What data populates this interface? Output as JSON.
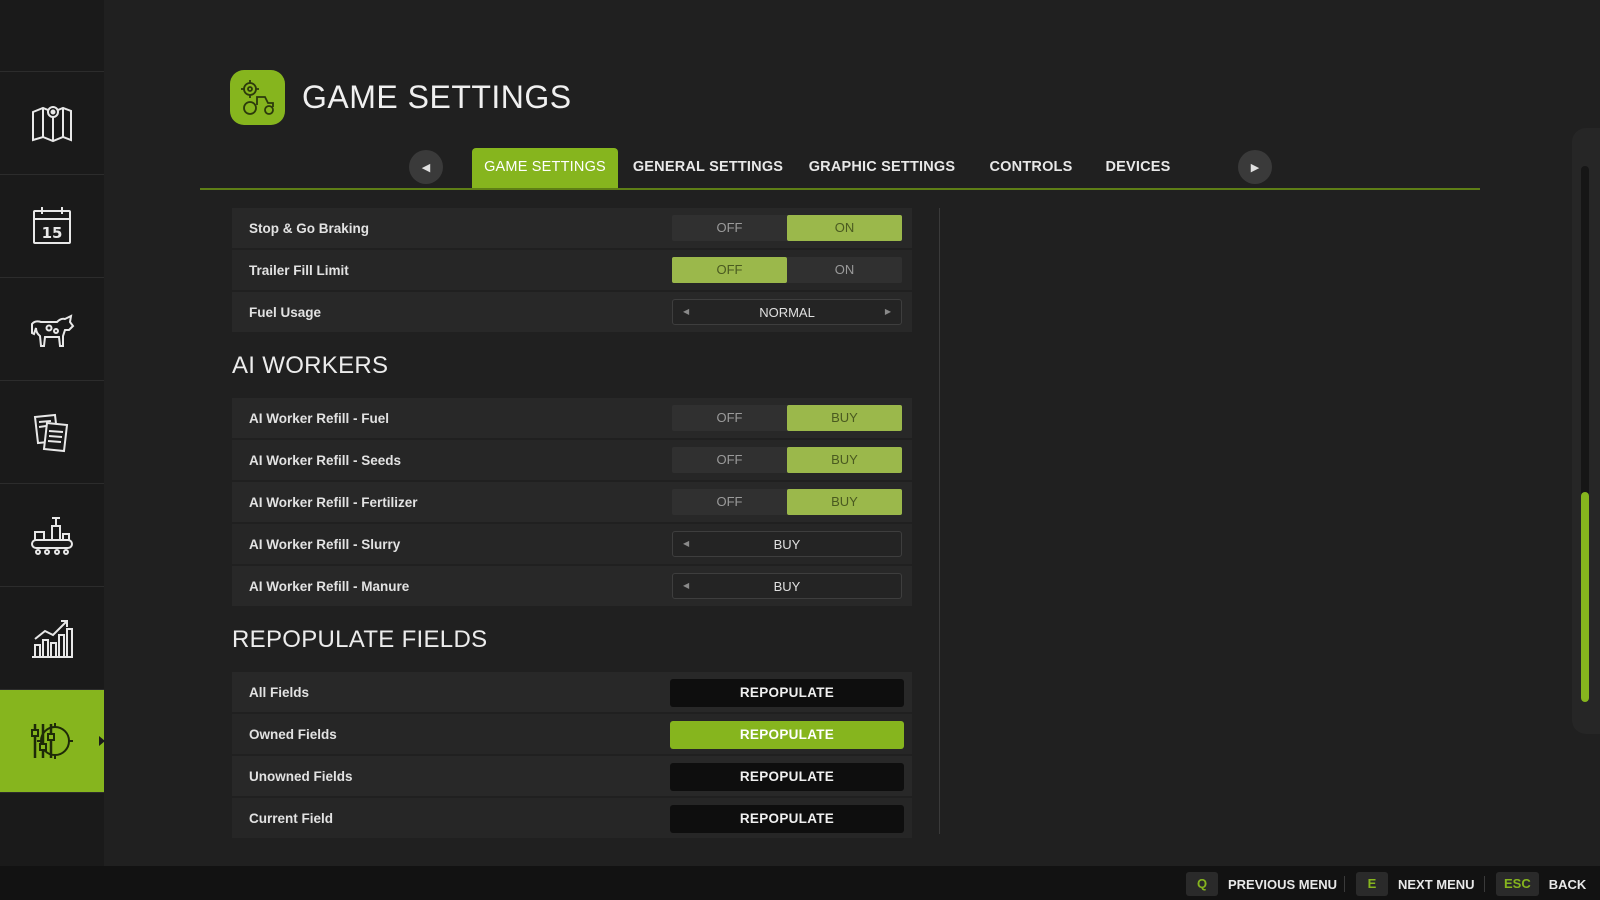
{
  "header": {
    "title": "GAME SETTINGS",
    "logo_icon": "tractor-gear-icon"
  },
  "sidebar": {
    "items": [
      {
        "name": "map",
        "icon": "map-icon",
        "active": false
      },
      {
        "name": "calendar",
        "icon": "calendar-icon",
        "label": "15",
        "active": false
      },
      {
        "name": "animals",
        "icon": "cow-icon",
        "active": false
      },
      {
        "name": "contracts",
        "icon": "documents-icon",
        "active": false
      },
      {
        "name": "production",
        "icon": "factory-icon",
        "active": false
      },
      {
        "name": "statistics",
        "icon": "bar-chart-icon",
        "active": false
      },
      {
        "name": "settings",
        "icon": "settings-sliders-icon",
        "active": true
      }
    ]
  },
  "tabs": [
    {
      "label": "GAME SETTINGS",
      "active": true
    },
    {
      "label": "GENERAL SETTINGS",
      "active": false
    },
    {
      "label": "GRAPHIC SETTINGS",
      "active": false
    },
    {
      "label": "CONTROLS",
      "active": false
    },
    {
      "label": "DEVICES",
      "active": false
    }
  ],
  "settings_top": [
    {
      "label": "Stop & Go Braking",
      "type": "toggle",
      "options": [
        "OFF",
        "ON"
      ],
      "selected": 1
    },
    {
      "label": "Trailer Fill Limit",
      "type": "toggle",
      "options": [
        "OFF",
        "ON"
      ],
      "selected": 0
    },
    {
      "label": "Fuel Usage",
      "type": "selector",
      "value": "NORMAL"
    }
  ],
  "sections": {
    "ai_workers": "AI WORKERS",
    "repopulate": "REPOPULATE FIELDS"
  },
  "ai_workers": [
    {
      "label": "AI Worker Refill - Fuel",
      "type": "toggle",
      "options": [
        "OFF",
        "BUY"
      ],
      "selected": 1
    },
    {
      "label": "AI Worker Refill - Seeds",
      "type": "toggle",
      "options": [
        "OFF",
        "BUY"
      ],
      "selected": 1
    },
    {
      "label": "AI Worker Refill - Fertilizer",
      "type": "toggle",
      "options": [
        "OFF",
        "BUY"
      ],
      "selected": 1
    },
    {
      "label": "AI Worker Refill - Slurry",
      "type": "selector",
      "value": "BUY"
    },
    {
      "label": "AI Worker Refill - Manure",
      "type": "selector",
      "value": "BUY"
    }
  ],
  "repopulate": [
    {
      "label": "All Fields",
      "button": "REPOPULATE",
      "highlight": false
    },
    {
      "label": "Owned Fields",
      "button": "REPOPULATE",
      "highlight": true
    },
    {
      "label": "Unowned Fields",
      "button": "REPOPULATE",
      "highlight": false
    },
    {
      "label": "Current Field",
      "button": "REPOPULATE",
      "highlight": false
    }
  ],
  "footer": {
    "prev": {
      "key": "Q",
      "label": "PREVIOUS MENU"
    },
    "next": {
      "key": "E",
      "label": "NEXT MENU"
    },
    "back": {
      "key": "ESC",
      "label": "BACK"
    }
  },
  "colors": {
    "accent": "#86b51e",
    "toggle_on": "#9bb84b",
    "background": "#202020"
  }
}
